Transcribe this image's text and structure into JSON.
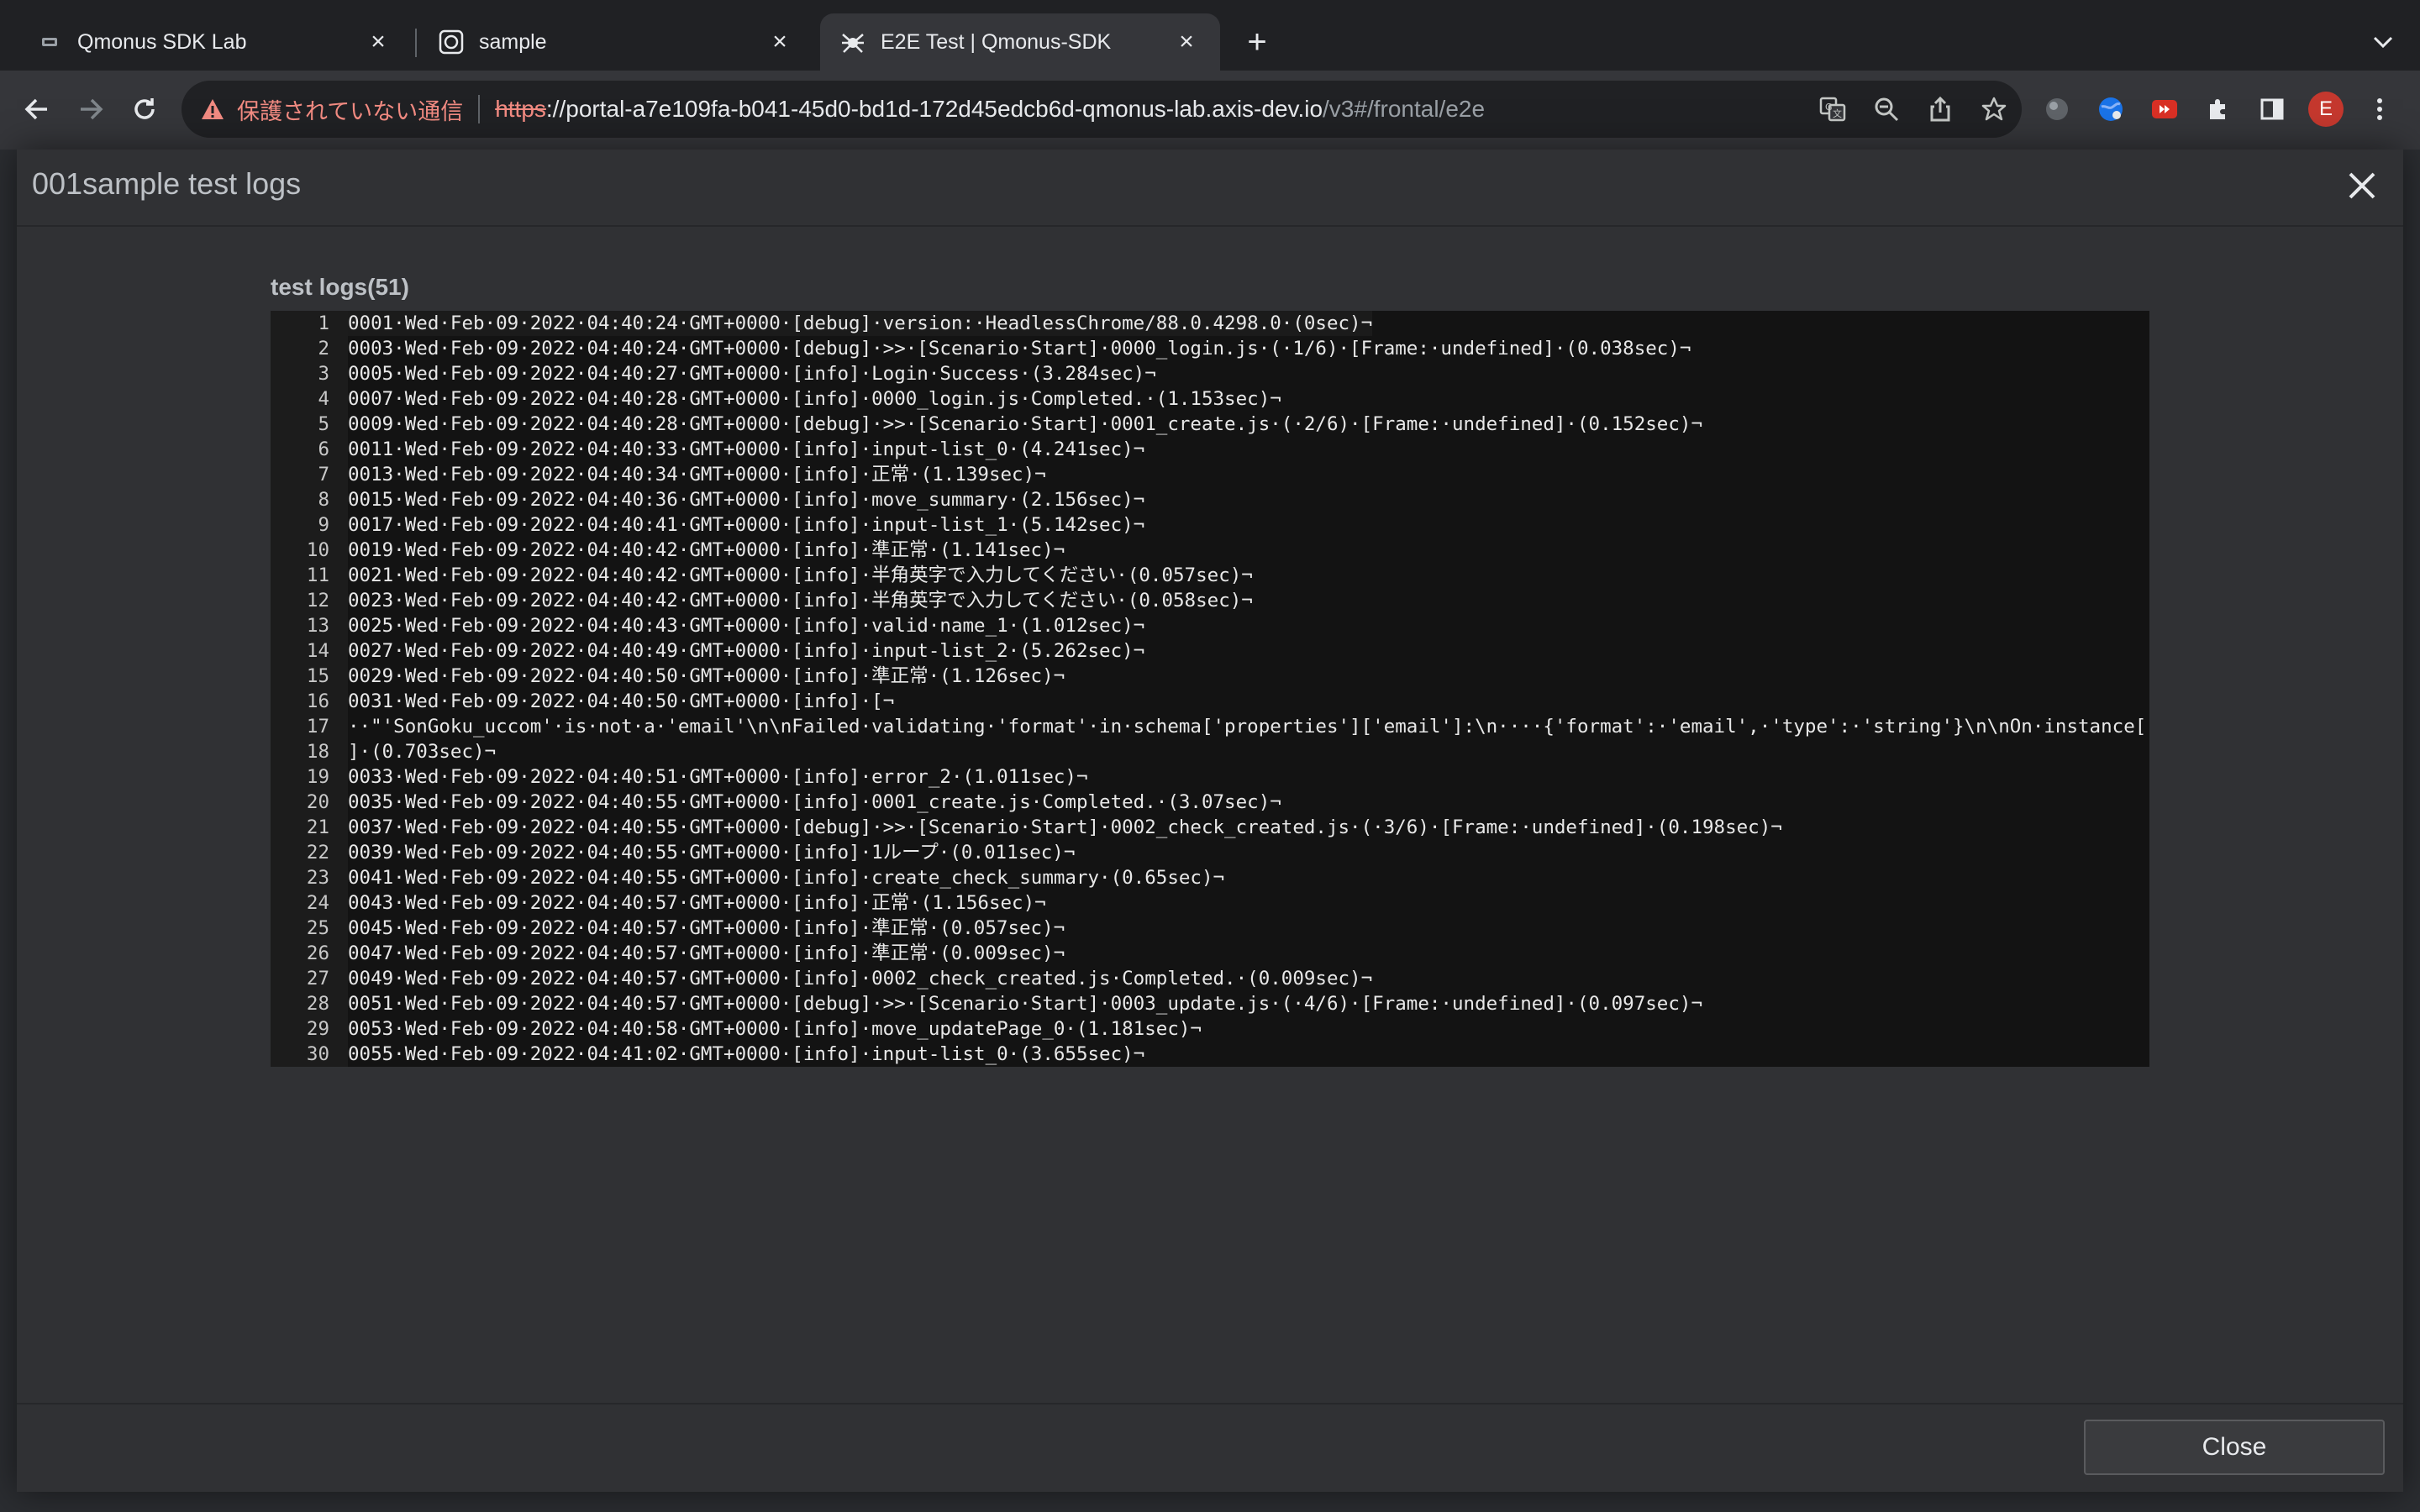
{
  "browser": {
    "tabs": [
      {
        "title": "Qmonus SDK Lab",
        "favicon": "qmonus-icon",
        "active": false
      },
      {
        "title": "sample",
        "favicon": "globe-icon",
        "active": false
      },
      {
        "title": "E2E Test | Qmonus-SDK",
        "favicon": "spider-icon",
        "active": true
      }
    ],
    "address": {
      "security_status": "保護されていない通信",
      "url_scheme": "https",
      "url_host": "://portal-a7e109fa-b041-45d0-bd1d-172d45edcb6d-qmonus-lab.axis-dev.io",
      "url_path": "/v3#/frontal/e2e"
    },
    "profile_initial": "E"
  },
  "modal": {
    "title": "001sample test logs",
    "logs_heading": "test logs(51)",
    "close_label": "Close",
    "log_lines": [
      {
        "n": "1",
        "text": "0001·Wed·Feb·09·2022·04:40:24·GMT+0000·[debug]·version:·HeadlessChrome/88.0.4298.0·(0sec)¬"
      },
      {
        "n": "2",
        "text": "0003·Wed·Feb·09·2022·04:40:24·GMT+0000·[debug]·>>·[Scenario·Start]·0000_login.js·(·1/6)·[Frame:·undefined]·(0.038sec)¬"
      },
      {
        "n": "3",
        "text": "0005·Wed·Feb·09·2022·04:40:27·GMT+0000·[info]·Login·Success·(3.284sec)¬"
      },
      {
        "n": "4",
        "text": "0007·Wed·Feb·09·2022·04:40:28·GMT+0000·[info]·0000_login.js·Completed.·(1.153sec)¬"
      },
      {
        "n": "5",
        "text": "0009·Wed·Feb·09·2022·04:40:28·GMT+0000·[debug]·>>·[Scenario·Start]·0001_create.js·(·2/6)·[Frame:·undefined]·(0.152sec)¬"
      },
      {
        "n": "6",
        "text": "0011·Wed·Feb·09·2022·04:40:33·GMT+0000·[info]·input-list_0·(4.241sec)¬"
      },
      {
        "n": "7",
        "text": "0013·Wed·Feb·09·2022·04:40:34·GMT+0000·[info]·正常·(1.139sec)¬"
      },
      {
        "n": "8",
        "text": "0015·Wed·Feb·09·2022·04:40:36·GMT+0000·[info]·move_summary·(2.156sec)¬"
      },
      {
        "n": "9",
        "text": "0017·Wed·Feb·09·2022·04:40:41·GMT+0000·[info]·input-list_1·(5.142sec)¬"
      },
      {
        "n": "10",
        "text": "0019·Wed·Feb·09·2022·04:40:42·GMT+0000·[info]·準正常·(1.141sec)¬"
      },
      {
        "n": "11",
        "text": "0021·Wed·Feb·09·2022·04:40:42·GMT+0000·[info]·半角英字で入力してください·(0.057sec)¬"
      },
      {
        "n": "12",
        "text": "0023·Wed·Feb·09·2022·04:40:42·GMT+0000·[info]·半角英字で入力してください·(0.058sec)¬"
      },
      {
        "n": "13",
        "text": "0025·Wed·Feb·09·2022·04:40:43·GMT+0000·[info]·valid·name_1·(1.012sec)¬"
      },
      {
        "n": "14",
        "text": "0027·Wed·Feb·09·2022·04:40:49·GMT+0000·[info]·input-list_2·(5.262sec)¬"
      },
      {
        "n": "15",
        "text": "0029·Wed·Feb·09·2022·04:40:50·GMT+0000·[info]·準正常·(1.126sec)¬"
      },
      {
        "n": "16",
        "text": "0031·Wed·Feb·09·2022·04:40:50·GMT+0000·[info]·[¬"
      },
      {
        "n": "17",
        "text": "··\"'SonGoku_uccom'·is·not·a·'email'\\n\\nFailed·validating·'format'·in·schema['properties']['email']:\\n····{'format':·'email',·'type':·'string'}\\n\\nOn·instance['email']"
      },
      {
        "n": "18",
        "text": "]·(0.703sec)¬"
      },
      {
        "n": "19",
        "text": "0033·Wed·Feb·09·2022·04:40:51·GMT+0000·[info]·error_2·(1.011sec)¬"
      },
      {
        "n": "20",
        "text": "0035·Wed·Feb·09·2022·04:40:55·GMT+0000·[info]·0001_create.js·Completed.·(3.07sec)¬"
      },
      {
        "n": "21",
        "text": "0037·Wed·Feb·09·2022·04:40:55·GMT+0000·[debug]·>>·[Scenario·Start]·0002_check_created.js·(·3/6)·[Frame:·undefined]·(0.198sec)¬"
      },
      {
        "n": "22",
        "text": "0039·Wed·Feb·09·2022·04:40:55·GMT+0000·[info]·1ループ·(0.011sec)¬"
      },
      {
        "n": "23",
        "text": "0041·Wed·Feb·09·2022·04:40:55·GMT+0000·[info]·create_check_summary·(0.65sec)¬"
      },
      {
        "n": "24",
        "text": "0043·Wed·Feb·09·2022·04:40:57·GMT+0000·[info]·正常·(1.156sec)¬"
      },
      {
        "n": "25",
        "text": "0045·Wed·Feb·09·2022·04:40:57·GMT+0000·[info]·準正常·(0.057sec)¬"
      },
      {
        "n": "26",
        "text": "0047·Wed·Feb·09·2022·04:40:57·GMT+0000·[info]·準正常·(0.009sec)¬"
      },
      {
        "n": "27",
        "text": "0049·Wed·Feb·09·2022·04:40:57·GMT+0000·[info]·0002_check_created.js·Completed.·(0.009sec)¬"
      },
      {
        "n": "28",
        "text": "0051·Wed·Feb·09·2022·04:40:57·GMT+0000·[debug]·>>·[Scenario·Start]·0003_update.js·(·4/6)·[Frame:·undefined]·(0.097sec)¬"
      },
      {
        "n": "29",
        "text": "0053·Wed·Feb·09·2022·04:40:58·GMT+0000·[info]·move_updatePage_0·(1.181sec)¬"
      },
      {
        "n": "30",
        "text": "0055·Wed·Feb·09·2022·04:41:02·GMT+0000·[info]·input-list_0·(3.655sec)¬"
      }
    ]
  },
  "colors": {
    "modal_bg": "#303134",
    "log_bg": "#131313",
    "insecure_red": "#f28b82",
    "avatar_red": "#c5382e"
  }
}
